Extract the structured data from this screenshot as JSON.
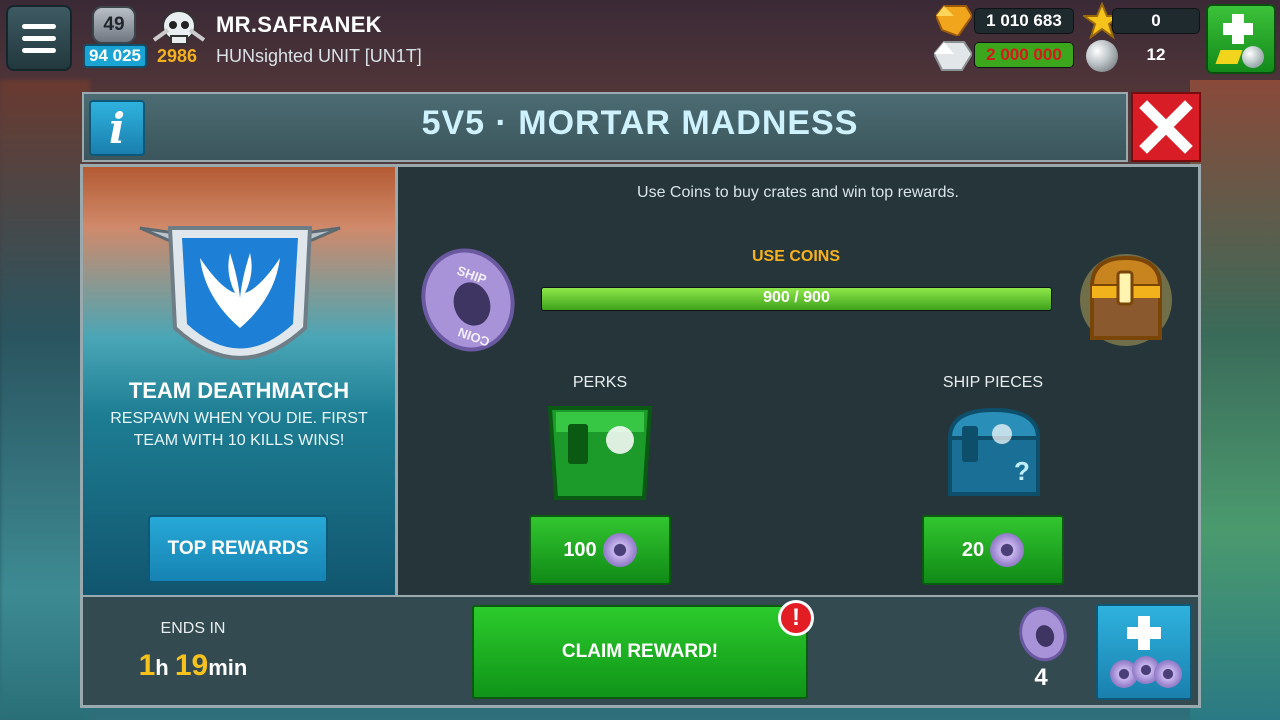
{
  "player": {
    "level": "49",
    "xp": "94 025",
    "rank_points": "2986",
    "name": "MR.SAFRANEK",
    "clan": "HUNsighted UNIT [UN1T]"
  },
  "currency": {
    "gold": "1 010 683",
    "silver": "2 000 000",
    "stars": "0",
    "pearls": "12"
  },
  "event": {
    "title": "5V5 · MORTAR MADNESS",
    "mode_title": "TEAM DEATHMATCH",
    "mode_desc_1": "RESPAWN WHEN YOU DIE. FIRST",
    "mode_desc_2": "TEAM WITH 10 KILLS WINS!",
    "top_rewards_label": "TOP REWARDS",
    "hint": "Use Coins to buy crates and win top rewards.",
    "use_coins_label": "USE COINS",
    "progress_text": "900 / 900",
    "progress_fraction": 1.0,
    "perks_label": "PERKS",
    "ship_pieces_label": "SHIP PIECES",
    "perks_price": "100",
    "ship_pieces_price": "20",
    "ends_in_label": "ENDS IN",
    "ends_hours": "1",
    "ends_hours_unit": "h",
    "ends_minutes": "19",
    "ends_minutes_unit": "min",
    "claim_label": "CLAIM REWARD!",
    "alert": "!",
    "coin_count": "4",
    "coin_text": "SHIP COIN"
  },
  "colors": {
    "accent_green": "#2ccb2c",
    "accent_blue": "#1aa4d4",
    "close_red": "#d91d26",
    "gold_text": "#f7b21c"
  },
  "icons": [
    "menu-icon",
    "level-badge",
    "skull-icon",
    "gold-gem-icon",
    "silver-icon",
    "star-icon",
    "pearl-icon",
    "shop-plus-icon",
    "info-icon",
    "close-icon",
    "wing-shield-icon",
    "ship-coin-icon",
    "gold-chest-icon",
    "green-chest-icon",
    "blue-chest-icon",
    "alert-icon",
    "plus-coins-icon"
  ]
}
